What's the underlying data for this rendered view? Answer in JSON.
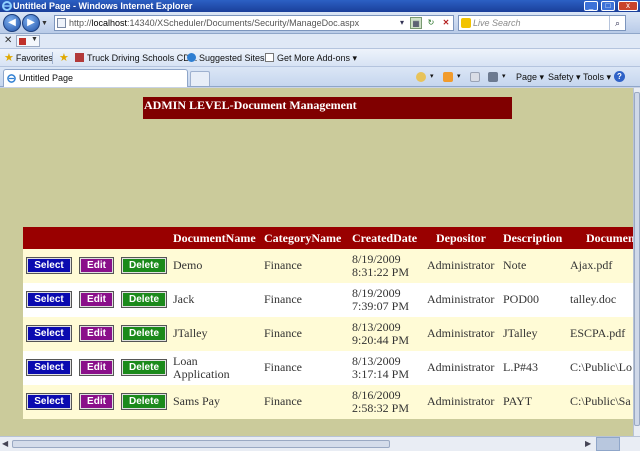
{
  "window": {
    "title": "Untitled Page - Windows Internet Explorer",
    "minimize": "_",
    "maximize": "□",
    "close": "x"
  },
  "address": {
    "url_prefix": "http://",
    "url_host": "localhost",
    "url_rest": ":14340/XScheduler/Documents/Security/ManageDoc.aspx",
    "search_placeholder": "Live Search"
  },
  "favorites": {
    "label": "Favorites",
    "items": [
      "Truck Driving Schools CD...",
      "Suggested Sites ▾",
      "Get More Add-ons ▾"
    ]
  },
  "tab": {
    "label": "Untitled Page"
  },
  "commands": {
    "page": "Page ▾",
    "safety": "Safety ▾",
    "tools": "Tools ▾",
    "help": "?"
  },
  "page": {
    "banner": "ADMIN LEVEL-Document Management"
  },
  "grid": {
    "columns": [
      "DocumentName",
      "CategoryName",
      "CreatedDate",
      "Depositor",
      "Description",
      "Documen"
    ],
    "buttons": {
      "select": "Select",
      "edit": "Edit",
      "delete": "Delete"
    },
    "rows": [
      {
        "name1": "Demo",
        "name2": "",
        "category": "Finance",
        "date": "8/19/2009",
        "time": "8:31:22 PM",
        "depositor": "Administrator",
        "description": "Note",
        "document": "Ajax.pdf"
      },
      {
        "name1": "Jack",
        "name2": "",
        "category": "Finance",
        "date": "8/19/2009",
        "time": "7:39:07 PM",
        "depositor": "Administrator",
        "description": "POD00",
        "document": "talley.doc"
      },
      {
        "name1": "JTalley",
        "name2": "",
        "category": "Finance",
        "date": "8/13/2009",
        "time": "9:20:44 PM",
        "depositor": "Administrator",
        "description": "JTalley",
        "document": "ESCPA.pdf"
      },
      {
        "name1": "Loan",
        "name2": "Application",
        "category": "Finance",
        "date": "8/13/2009",
        "time": "3:17:14 PM",
        "depositor": "Administrator",
        "description": "L.P#43",
        "document": "C:\\Public\\Lo"
      },
      {
        "name1": "Sams Pay",
        "name2": "",
        "category": "Finance",
        "date": "8/16/2009",
        "time": "2:58:32 PM",
        "depositor": "Administrator",
        "description": "PAYT",
        "document": "C:\\Public\\Sa"
      }
    ]
  }
}
